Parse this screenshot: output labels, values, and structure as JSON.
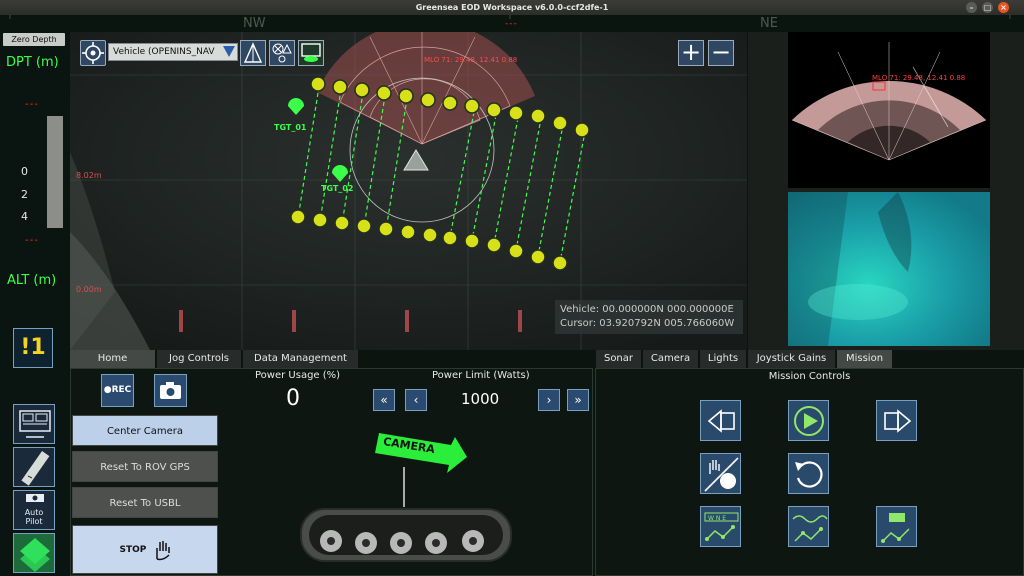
{
  "window": {
    "title": "Greensea EOD Workspace v6.0.0-ccf2dfe-1",
    "min": "–",
    "max": "□",
    "close": "×"
  },
  "compass": {
    "nw": "NW",
    "ne": "NE",
    "heading": "---"
  },
  "left": {
    "zero_depth": "Zero Depth",
    "dpt_label": "DPT (m)",
    "alt_label": "ALT (m)",
    "dpt_dash": "---",
    "alt_dash": "---",
    "ticks": [
      "0",
      "2",
      "4"
    ],
    "warning_icon": "!",
    "warning_count": "1",
    "autopilot": [
      "Auto",
      "Pilot"
    ]
  },
  "map": {
    "vehicle_select": "Vehicle (OPENINS_NAV",
    "left_scale_1": "8.02m",
    "left_scale_2": "0.00m",
    "target_1": "TGT_01",
    "target_2": "TGT_02",
    "mlo_label": "MLO 71: 29.48, 12.41 0.88",
    "zoom_in": "+",
    "zoom_out": "−",
    "vehicle_coords": "Vehicle: 00.000000N 000.000000E",
    "cursor_coords": "Cursor: 03.920792N 005.766060W"
  },
  "sonar": {
    "mlo_label": "MLO 71: 29.48, 12.41 0.88"
  },
  "tabs_left": [
    "Home",
    "Jog Controls",
    "Data Management"
  ],
  "tabs_right": [
    "Sonar",
    "Camera",
    "Lights",
    "Joystick Gains",
    "Mission"
  ],
  "home": {
    "rec": "●REC",
    "center_camera": "Center Camera",
    "reset_gps": "Reset To ROV GPS",
    "reset_usbl": "Reset To USBL",
    "stop": "STOP",
    "power_usage_label": "Power Usage (%)",
    "power_usage_value": "0",
    "power_limit_label": "Power Limit (Watts)",
    "power_limit_value": "1000",
    "step_fast_down": "«",
    "step_down": "‹",
    "step_up": "›",
    "step_fast_up": "»",
    "camera_sign": "CAMERA"
  },
  "mission": {
    "title": "Mission Controls",
    "compass_icon_letters": "W N E"
  },
  "colors": {
    "accent_green": "#3cff4a",
    "warning_red": "#ff2424",
    "button_blue": "#2a4a70",
    "mission_icon": "#8fe86a"
  }
}
